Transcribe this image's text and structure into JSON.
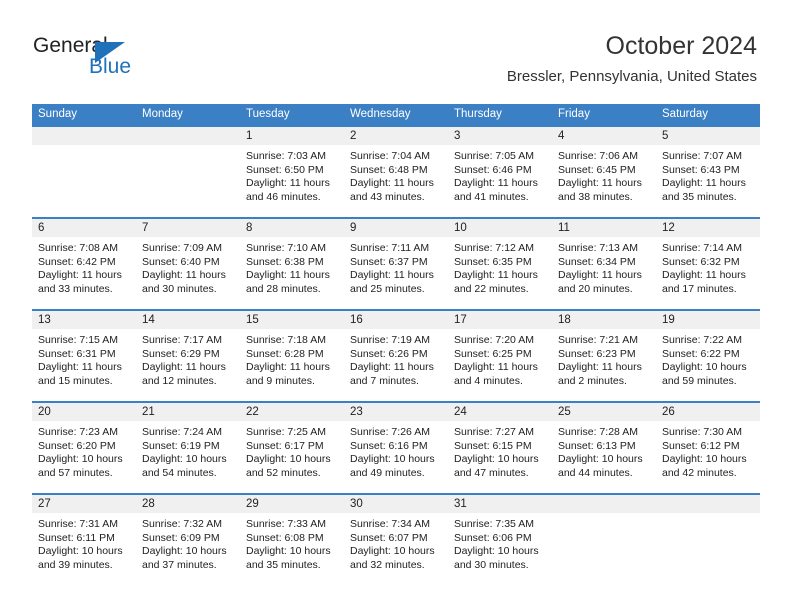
{
  "logo": {
    "word_general": "General",
    "word_blue": "Blue",
    "triangle_color": "#1f72b9"
  },
  "header": {
    "month_title": "October 2024",
    "location": "Bressler, Pennsylvania, United States"
  },
  "colors": {
    "header_band": "#3b7fc4",
    "daynum_band": "#f0f0f0",
    "text": "#222222"
  },
  "weekdays": [
    "Sunday",
    "Monday",
    "Tuesday",
    "Wednesday",
    "Thursday",
    "Friday",
    "Saturday"
  ],
  "weeks": [
    [
      {
        "day": "",
        "empty": true
      },
      {
        "day": "",
        "empty": true
      },
      {
        "day": "1",
        "sunrise": "Sunrise: 7:03 AM",
        "sunset": "Sunset: 6:50 PM",
        "daylight1": "Daylight: 11 hours",
        "daylight2": "and 46 minutes."
      },
      {
        "day": "2",
        "sunrise": "Sunrise: 7:04 AM",
        "sunset": "Sunset: 6:48 PM",
        "daylight1": "Daylight: 11 hours",
        "daylight2": "and 43 minutes."
      },
      {
        "day": "3",
        "sunrise": "Sunrise: 7:05 AM",
        "sunset": "Sunset: 6:46 PM",
        "daylight1": "Daylight: 11 hours",
        "daylight2": "and 41 minutes."
      },
      {
        "day": "4",
        "sunrise": "Sunrise: 7:06 AM",
        "sunset": "Sunset: 6:45 PM",
        "daylight1": "Daylight: 11 hours",
        "daylight2": "and 38 minutes."
      },
      {
        "day": "5",
        "sunrise": "Sunrise: 7:07 AM",
        "sunset": "Sunset: 6:43 PM",
        "daylight1": "Daylight: 11 hours",
        "daylight2": "and 35 minutes."
      }
    ],
    [
      {
        "day": "6",
        "sunrise": "Sunrise: 7:08 AM",
        "sunset": "Sunset: 6:42 PM",
        "daylight1": "Daylight: 11 hours",
        "daylight2": "and 33 minutes."
      },
      {
        "day": "7",
        "sunrise": "Sunrise: 7:09 AM",
        "sunset": "Sunset: 6:40 PM",
        "daylight1": "Daylight: 11 hours",
        "daylight2": "and 30 minutes."
      },
      {
        "day": "8",
        "sunrise": "Sunrise: 7:10 AM",
        "sunset": "Sunset: 6:38 PM",
        "daylight1": "Daylight: 11 hours",
        "daylight2": "and 28 minutes."
      },
      {
        "day": "9",
        "sunrise": "Sunrise: 7:11 AM",
        "sunset": "Sunset: 6:37 PM",
        "daylight1": "Daylight: 11 hours",
        "daylight2": "and 25 minutes."
      },
      {
        "day": "10",
        "sunrise": "Sunrise: 7:12 AM",
        "sunset": "Sunset: 6:35 PM",
        "daylight1": "Daylight: 11 hours",
        "daylight2": "and 22 minutes."
      },
      {
        "day": "11",
        "sunrise": "Sunrise: 7:13 AM",
        "sunset": "Sunset: 6:34 PM",
        "daylight1": "Daylight: 11 hours",
        "daylight2": "and 20 minutes."
      },
      {
        "day": "12",
        "sunrise": "Sunrise: 7:14 AM",
        "sunset": "Sunset: 6:32 PM",
        "daylight1": "Daylight: 11 hours",
        "daylight2": "and 17 minutes."
      }
    ],
    [
      {
        "day": "13",
        "sunrise": "Sunrise: 7:15 AM",
        "sunset": "Sunset: 6:31 PM",
        "daylight1": "Daylight: 11 hours",
        "daylight2": "and 15 minutes."
      },
      {
        "day": "14",
        "sunrise": "Sunrise: 7:17 AM",
        "sunset": "Sunset: 6:29 PM",
        "daylight1": "Daylight: 11 hours",
        "daylight2": "and 12 minutes."
      },
      {
        "day": "15",
        "sunrise": "Sunrise: 7:18 AM",
        "sunset": "Sunset: 6:28 PM",
        "daylight1": "Daylight: 11 hours",
        "daylight2": "and 9 minutes."
      },
      {
        "day": "16",
        "sunrise": "Sunrise: 7:19 AM",
        "sunset": "Sunset: 6:26 PM",
        "daylight1": "Daylight: 11 hours",
        "daylight2": "and 7 minutes."
      },
      {
        "day": "17",
        "sunrise": "Sunrise: 7:20 AM",
        "sunset": "Sunset: 6:25 PM",
        "daylight1": "Daylight: 11 hours",
        "daylight2": "and 4 minutes."
      },
      {
        "day": "18",
        "sunrise": "Sunrise: 7:21 AM",
        "sunset": "Sunset: 6:23 PM",
        "daylight1": "Daylight: 11 hours",
        "daylight2": "and 2 minutes."
      },
      {
        "day": "19",
        "sunrise": "Sunrise: 7:22 AM",
        "sunset": "Sunset: 6:22 PM",
        "daylight1": "Daylight: 10 hours",
        "daylight2": "and 59 minutes."
      }
    ],
    [
      {
        "day": "20",
        "sunrise": "Sunrise: 7:23 AM",
        "sunset": "Sunset: 6:20 PM",
        "daylight1": "Daylight: 10 hours",
        "daylight2": "and 57 minutes."
      },
      {
        "day": "21",
        "sunrise": "Sunrise: 7:24 AM",
        "sunset": "Sunset: 6:19 PM",
        "daylight1": "Daylight: 10 hours",
        "daylight2": "and 54 minutes."
      },
      {
        "day": "22",
        "sunrise": "Sunrise: 7:25 AM",
        "sunset": "Sunset: 6:17 PM",
        "daylight1": "Daylight: 10 hours",
        "daylight2": "and 52 minutes."
      },
      {
        "day": "23",
        "sunrise": "Sunrise: 7:26 AM",
        "sunset": "Sunset: 6:16 PM",
        "daylight1": "Daylight: 10 hours",
        "daylight2": "and 49 minutes."
      },
      {
        "day": "24",
        "sunrise": "Sunrise: 7:27 AM",
        "sunset": "Sunset: 6:15 PM",
        "daylight1": "Daylight: 10 hours",
        "daylight2": "and 47 minutes."
      },
      {
        "day": "25",
        "sunrise": "Sunrise: 7:28 AM",
        "sunset": "Sunset: 6:13 PM",
        "daylight1": "Daylight: 10 hours",
        "daylight2": "and 44 minutes."
      },
      {
        "day": "26",
        "sunrise": "Sunrise: 7:30 AM",
        "sunset": "Sunset: 6:12 PM",
        "daylight1": "Daylight: 10 hours",
        "daylight2": "and 42 minutes."
      }
    ],
    [
      {
        "day": "27",
        "sunrise": "Sunrise: 7:31 AM",
        "sunset": "Sunset: 6:11 PM",
        "daylight1": "Daylight: 10 hours",
        "daylight2": "and 39 minutes."
      },
      {
        "day": "28",
        "sunrise": "Sunrise: 7:32 AM",
        "sunset": "Sunset: 6:09 PM",
        "daylight1": "Daylight: 10 hours",
        "daylight2": "and 37 minutes."
      },
      {
        "day": "29",
        "sunrise": "Sunrise: 7:33 AM",
        "sunset": "Sunset: 6:08 PM",
        "daylight1": "Daylight: 10 hours",
        "daylight2": "and 35 minutes."
      },
      {
        "day": "30",
        "sunrise": "Sunrise: 7:34 AM",
        "sunset": "Sunset: 6:07 PM",
        "daylight1": "Daylight: 10 hours",
        "daylight2": "and 32 minutes."
      },
      {
        "day": "31",
        "sunrise": "Sunrise: 7:35 AM",
        "sunset": "Sunset: 6:06 PM",
        "daylight1": "Daylight: 10 hours",
        "daylight2": "and 30 minutes."
      },
      {
        "day": "",
        "empty": true
      },
      {
        "day": "",
        "empty": true
      }
    ]
  ]
}
